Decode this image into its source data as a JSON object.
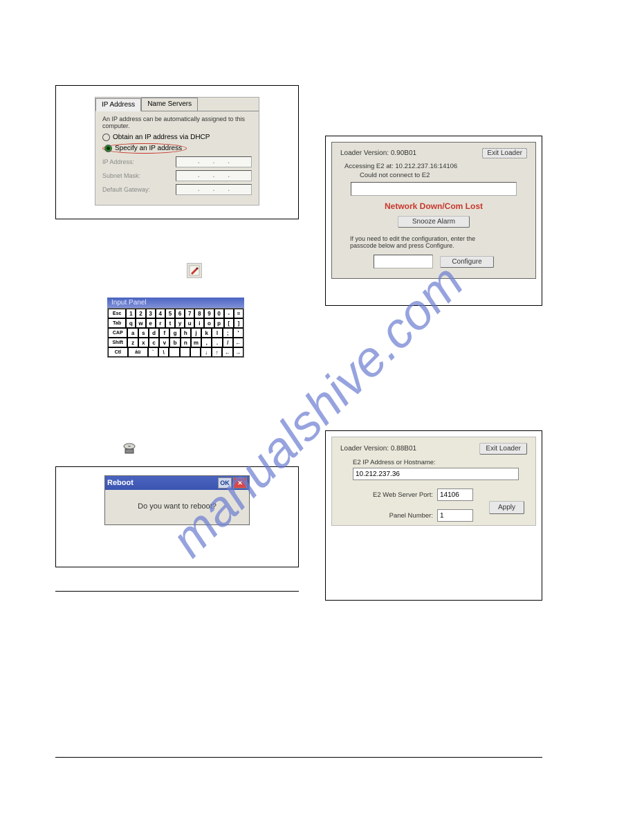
{
  "watermark": "manualshive.com",
  "ip_dialog": {
    "tabs": {
      "ip": "IP Address",
      "ns": "Name Servers"
    },
    "description": "An IP address can be automatically assigned to this computer.",
    "radio_dhcp": "Obtain an IP address via DHCP",
    "radio_specify": "Specify an IP address",
    "fields": {
      "ip_label": "IP Address:",
      "ip_value": ".   .   .",
      "subnet_label": "Subnet Mask:",
      "subnet_value": ".   .   .",
      "gateway_label": "Default Gateway:",
      "gateway_value": ".   .   ."
    }
  },
  "kbd_title": "Input Panel",
  "kbd": {
    "row1": [
      "Esc",
      "1",
      "2",
      "3",
      "4",
      "5",
      "6",
      "7",
      "8",
      "9",
      "0",
      "-",
      "="
    ],
    "row2": [
      "Tab",
      "q",
      "w",
      "e",
      "r",
      "t",
      "y",
      "u",
      "i",
      "o",
      "p",
      "[",
      "]"
    ],
    "row3": [
      "CAP",
      "a",
      "s",
      "d",
      "f",
      "g",
      "h",
      "j",
      "k",
      "l",
      ";",
      "'"
    ],
    "row4": [
      "Shift",
      "z",
      "x",
      "c",
      "v",
      "b",
      "n",
      "m",
      ",",
      ".",
      "/",
      "←"
    ],
    "row5": [
      "Ctl",
      "áü",
      "`",
      "\\",
      " ",
      " ",
      " ",
      "↓",
      "↑",
      "←",
      "→"
    ]
  },
  "reboot": {
    "title": "Reboot",
    "ok": "OK",
    "close": "✕",
    "body": "Do you want to reboot?"
  },
  "loader1": {
    "version_label": "Loader Version: 0.90B01",
    "exit": "Exit Loader",
    "accessing": "Accessing E2 at: 10.212.237.16:14106",
    "could_not": "Could not connect to E2",
    "error": "Network Down/Com Lost",
    "snooze": "Snooze Alarm",
    "note": "If you need to edit the configuration, enter the passcode below and press Configure.",
    "configure": "Configure"
  },
  "loader2": {
    "version_label": "Loader Version: 0.88B01",
    "exit": "Exit Loader",
    "host_label": "E2 IP Address or Hostname:",
    "host_value": "10.212.237.36",
    "port_label": "E2 Web Server Port:",
    "port_value": "14106",
    "panel_label": "Panel Number:",
    "panel_value": "1",
    "apply": "Apply"
  }
}
